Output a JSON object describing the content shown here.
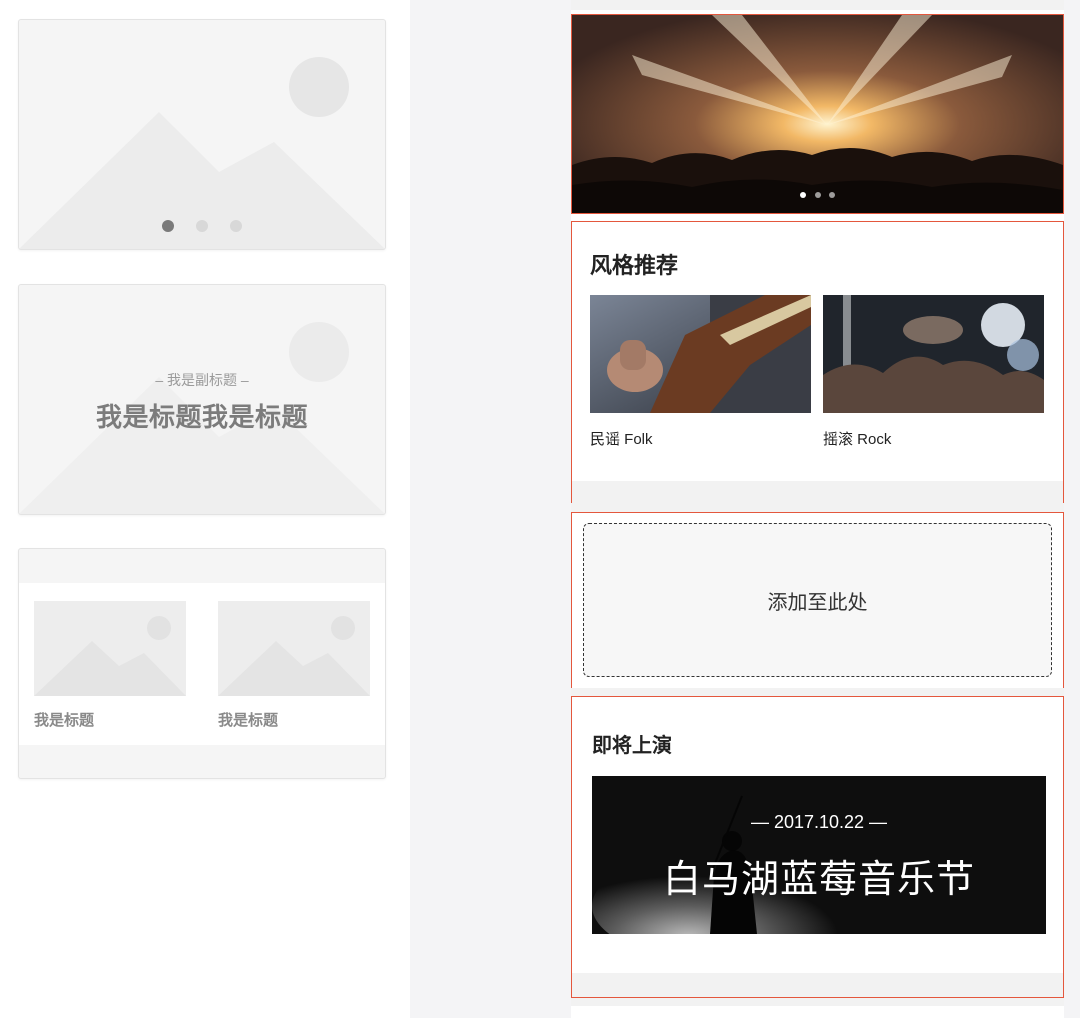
{
  "templates": {
    "banner_dots": 3,
    "title_card": {
      "subtitle": "– 我是副标题 –",
      "title": "我是标题我是标题"
    },
    "grid_card": {
      "item1_label": "我是标题",
      "item2_label": "我是标题"
    }
  },
  "style_section": {
    "title": "风格推荐",
    "items": [
      {
        "label": "民谣 Folk",
        "image": "guitar-photo"
      },
      {
        "label": "摇滚 Rock",
        "image": "concert-crowd-photo"
      }
    ]
  },
  "drop_zone": {
    "label": "添加至此处"
  },
  "upcoming": {
    "title": "即将上演",
    "event_date": "— 2017.10.22 —",
    "event_name": "白马湖蓝莓音乐节"
  },
  "colors": {
    "selection_border": "#e4573d",
    "placeholder": "#f5f5f5"
  }
}
